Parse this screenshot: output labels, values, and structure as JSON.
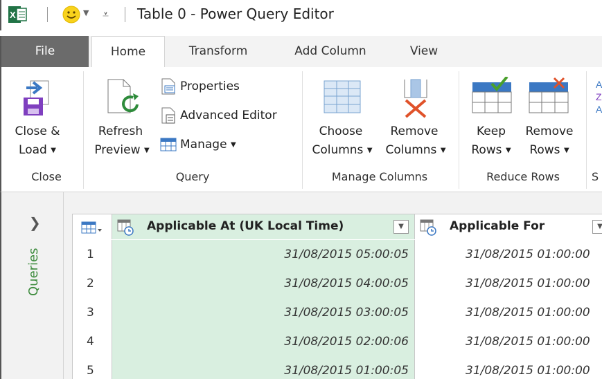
{
  "window": {
    "title": "Table 0 - Power Query Editor"
  },
  "tabs": [
    {
      "label": "File"
    },
    {
      "label": "Home"
    },
    {
      "label": "Transform"
    },
    {
      "label": "Add Column"
    },
    {
      "label": "View"
    }
  ],
  "ribbon": {
    "close": {
      "close_load_line1": "Close &",
      "close_load_line2": "Load",
      "group_label": "Close"
    },
    "query": {
      "refresh_line1": "Refresh",
      "refresh_line2": "Preview",
      "properties": "Properties",
      "advanced_editor": "Advanced Editor",
      "manage": "Manage",
      "group_label": "Query"
    },
    "manage_columns": {
      "choose_line1": "Choose",
      "choose_line2": "Columns",
      "remove_line1": "Remove",
      "remove_line2": "Columns",
      "group_label": "Manage Columns"
    },
    "reduce_rows": {
      "keep_line1": "Keep",
      "keep_line2": "Rows",
      "remove_line1": "Remove",
      "remove_line2": "Rows",
      "group_label": "Reduce Rows"
    },
    "next_group_initial": "S"
  },
  "queries_pane": {
    "label": "Queries"
  },
  "grid": {
    "columns": [
      {
        "header": "Applicable At (UK Local Time)"
      },
      {
        "header": "Applicable For"
      }
    ],
    "rows": [
      {
        "num": "1",
        "c1": "31/08/2015 05:00:05",
        "c2": "31/08/2015 01:00:00"
      },
      {
        "num": "2",
        "c1": "31/08/2015 04:00:05",
        "c2": "31/08/2015 01:00:00"
      },
      {
        "num": "3",
        "c1": "31/08/2015 03:00:05",
        "c2": "31/08/2015 01:00:00"
      },
      {
        "num": "4",
        "c1": "31/08/2015 02:00:06",
        "c2": "31/08/2015 01:00:00"
      },
      {
        "num": "5",
        "c1": "31/08/2015 01:00:05",
        "c2": "31/08/2015 01:00:00"
      }
    ]
  },
  "colors": {
    "excel_green": "#217346",
    "selected_column": "#d9efe0",
    "queries_green": "#3d8b3d",
    "file_tab": "#6b6b6b"
  }
}
